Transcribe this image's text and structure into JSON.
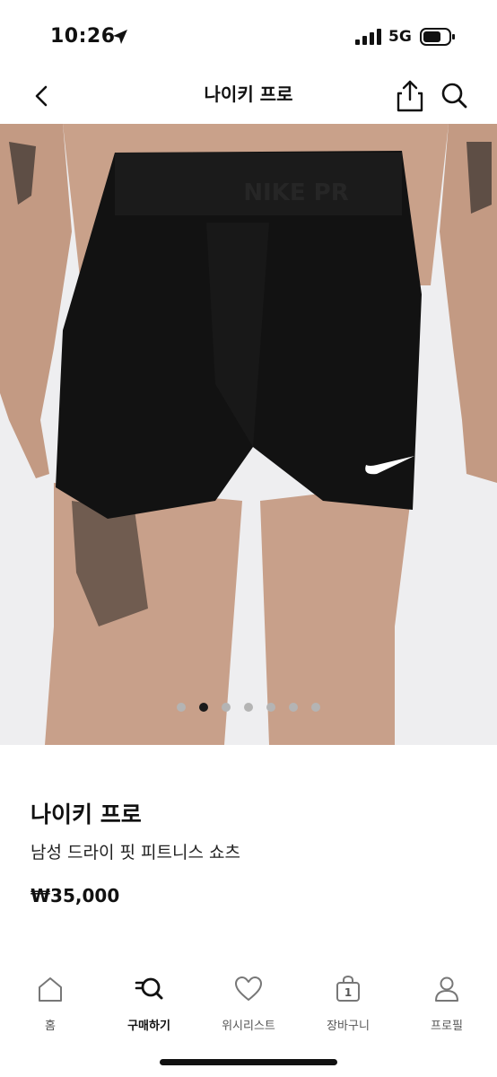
{
  "status_bar": {
    "time": "10:26",
    "network": "5G"
  },
  "header": {
    "title": "나이키 프로"
  },
  "product": {
    "image_count": 7,
    "active_image_index": 1,
    "brand": "나이키 프로",
    "name": "남성 드라이 핏 피트니스 쇼츠",
    "price": "₩35,000"
  },
  "tabs": [
    {
      "label": "홈",
      "icon": "home-icon",
      "active": false
    },
    {
      "label": "구매하기",
      "icon": "buy-search-icon",
      "active": true
    },
    {
      "label": "위시리스트",
      "icon": "heart-icon",
      "active": false
    },
    {
      "label": "장바구니",
      "icon": "cart-bag-icon",
      "active": false,
      "badge": "1"
    },
    {
      "label": "프로필",
      "icon": "person-icon",
      "active": false
    }
  ]
}
